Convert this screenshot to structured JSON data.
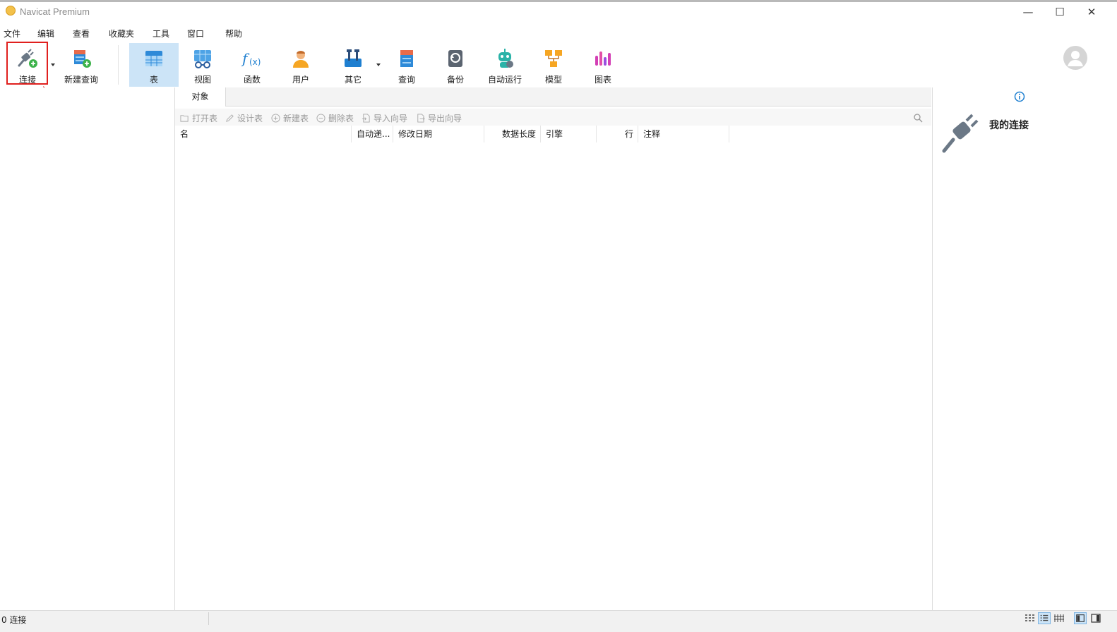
{
  "window": {
    "title": "Navicat Premium",
    "minimize_glyph": "—",
    "maximize_glyph": "☐",
    "close_glyph": "✕"
  },
  "menu": [
    "文件",
    "编辑",
    "查看",
    "收藏夹",
    "工具",
    "窗口",
    "帮助"
  ],
  "toolbar": {
    "connect": "连接",
    "new_query": "新建查询",
    "table": "表",
    "view": "视图",
    "function": "函数",
    "user": "用户",
    "other": "其它",
    "query": "查询",
    "backup": "备份",
    "automation": "自动运行",
    "model": "模型",
    "chart": "图表"
  },
  "tabs": {
    "objects": "对象"
  },
  "actions": {
    "open_table": "打开表",
    "design_table": "设计表",
    "new_table": "新建表",
    "delete_table": "删除表",
    "import_wizard": "导入向导",
    "export_wizard": "导出向导"
  },
  "columns": {
    "name": "名",
    "auto_increment": "自动递...",
    "modified_date": "修改日期",
    "data_length": "数据长度",
    "engine": "引擎",
    "rows": "行",
    "comment": "注释"
  },
  "info_panel": {
    "title": "我的连接"
  },
  "status": {
    "connections": "0 连接"
  },
  "colors": {
    "highlight_box": "#e0201e",
    "active_tool_bg": "#cce4f7",
    "accent_blue": "#1e7fd0"
  }
}
